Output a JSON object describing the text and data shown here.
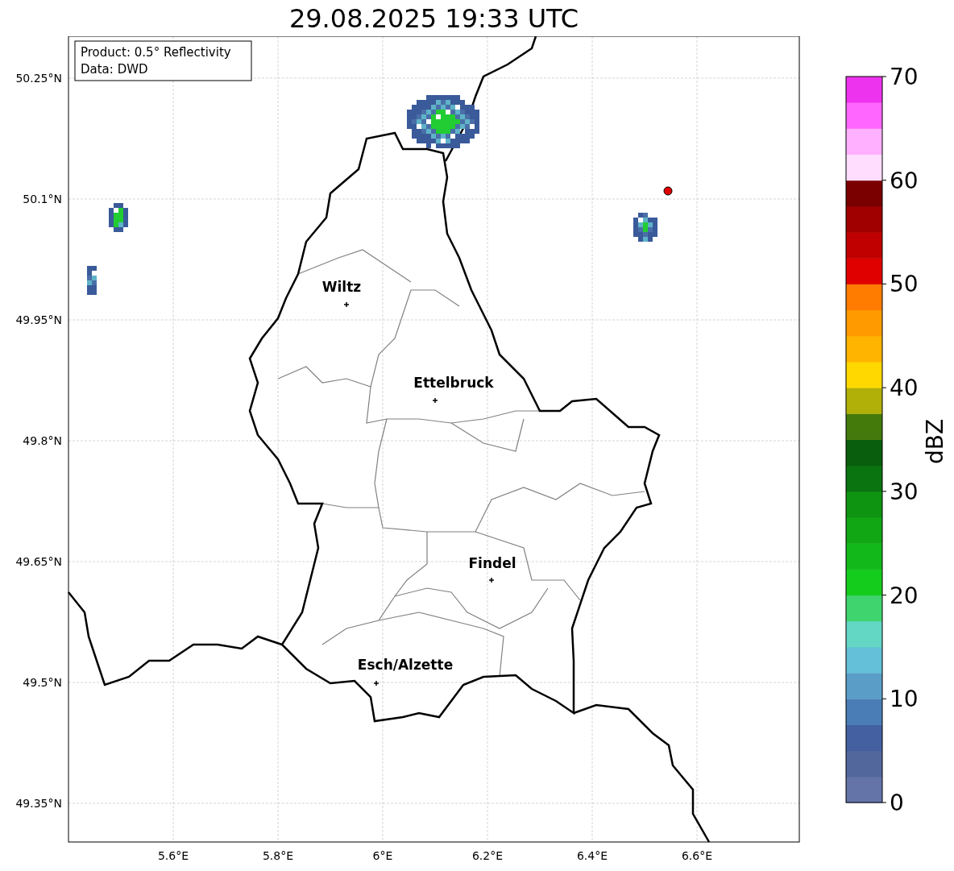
{
  "title": "29.08.2025 19:33 UTC",
  "info_box": {
    "lines": [
      "Product: 0.5° Reflectivity",
      "Data: DWD"
    ]
  },
  "map": {
    "lon_labels": [
      "5.6°E",
      "5.8°E",
      "6°E",
      "6.2°E",
      "6.4°E",
      "6.6°E"
    ],
    "lat_labels": [
      "50.25°N",
      "50.1°N",
      "49.95°N",
      "49.8°N",
      "49.65°N",
      "49.5°N",
      "49.35°N"
    ],
    "cities": [
      {
        "name": "Wiltz"
      },
      {
        "name": "Ettelbruck"
      },
      {
        "name": "Findel"
      },
      {
        "name": "Esch/Alzette"
      }
    ]
  },
  "colorbar": {
    "label": "dBZ",
    "ticks": [
      "70",
      "60",
      "50",
      "40",
      "30",
      "20",
      "10",
      "0"
    ],
    "segments": [
      {
        "color": "#6474a8"
      },
      {
        "color": "#52679c"
      },
      {
        "color": "#4460a0"
      },
      {
        "color": "#4a7db5"
      },
      {
        "color": "#5a9ec8"
      },
      {
        "color": "#63c0d8"
      },
      {
        "color": "#63d6c4"
      },
      {
        "color": "#3fd46e"
      },
      {
        "color": "#14cc1c"
      },
      {
        "color": "#12b81a"
      },
      {
        "color": "#10a614"
      },
      {
        "color": "#0e9410"
      },
      {
        "color": "#0a7410"
      },
      {
        "color": "#085e0c"
      },
      {
        "color": "#447a0c"
      },
      {
        "color": "#b0b008"
      },
      {
        "color": "#ffd800"
      },
      {
        "color": "#ffb400"
      },
      {
        "color": "#ff9a00"
      },
      {
        "color": "#ff7c00"
      },
      {
        "color": "#e00000"
      },
      {
        "color": "#c00000"
      },
      {
        "color": "#a00000"
      },
      {
        "color": "#7a0000"
      },
      {
        "color": "#ffddff"
      },
      {
        "color": "#ffb0ff"
      },
      {
        "color": "#ff66ff"
      },
      {
        "color": "#ee33ee"
      }
    ]
  }
}
